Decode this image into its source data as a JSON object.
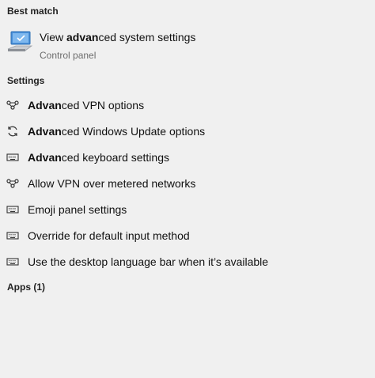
{
  "headers": {
    "best_match": "Best match",
    "settings": "Settings",
    "apps": "Apps (1)"
  },
  "best_match": {
    "title_pre": "View ",
    "title_bold": "advan",
    "title_post": "ced system settings",
    "subtitle": "Control panel",
    "icon": "computer-icon"
  },
  "settings": [
    {
      "bold": "Advan",
      "rest": "ced VPN options",
      "icon": "vpn-icon"
    },
    {
      "bold": "Advan",
      "rest": "ced Windows Update options",
      "icon": "update-icon"
    },
    {
      "bold": "Advan",
      "rest": "ced keyboard settings",
      "icon": "keyboard-icon"
    },
    {
      "bold": "",
      "rest": "Allow VPN over metered networks",
      "icon": "vpn-icon"
    },
    {
      "bold": "",
      "rest": "Emoji panel settings",
      "icon": "keyboard-icon"
    },
    {
      "bold": "",
      "rest": "Override for default input method",
      "icon": "keyboard-icon"
    },
    {
      "bold": "",
      "rest": "Use the desktop language bar when it’s available",
      "icon": "keyboard-icon"
    }
  ]
}
